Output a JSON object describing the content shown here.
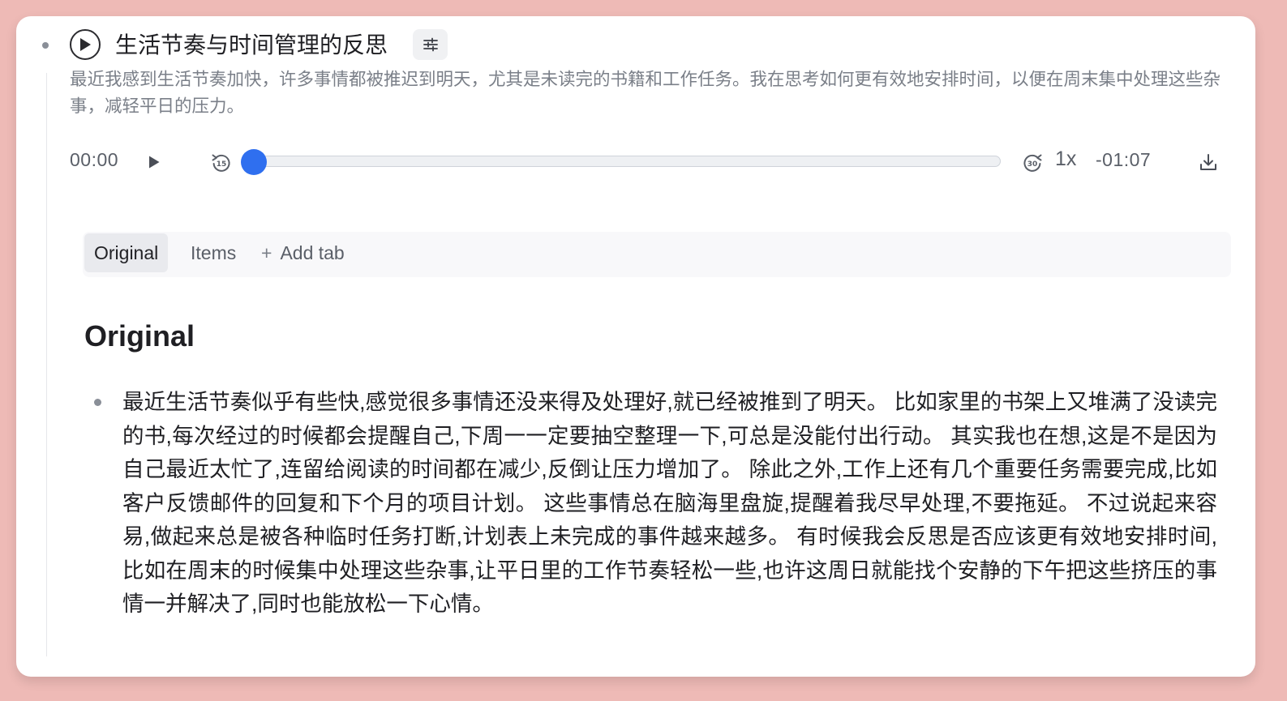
{
  "note": {
    "title": "生活节奏与时间管理的反思",
    "summary": "最近我感到生活节奏加快，许多事情都被推迟到明天，尤其是未读完的书籍和工作任务。我在思考如何更有效地安排时间，以便在周末集中处理这些杂事，减轻平日的压力。"
  },
  "player": {
    "current_time": "00:00",
    "remaining_time": "-01:07",
    "speed": "1x",
    "rewind_seconds": "15",
    "forward_seconds": "30",
    "progress": 0
  },
  "tabs": {
    "original": "Original",
    "items": "Items",
    "add": "Add tab",
    "add_symbol": "+"
  },
  "content": {
    "heading": "Original",
    "paragraph": "最近生活节奏似乎有些快,感觉很多事情还没来得及处理好,就已经被推到了明天。 比如家里的书架上又堆满了没读完的书,每次经过的时候都会提醒自己,下周一一定要抽空整理一下,可总是没能付出行动。 其实我也在想,这是不是因为自己最近太忙了,连留给阅读的时间都在减少,反倒让压力增加了。 除此之外,工作上还有几个重要任务需要完成,比如客户反馈邮件的回复和下个月的项目计划。 这些事情总在脑海里盘旋,提醒着我尽早处理,不要拖延。 不过说起来容易,做起来总是被各种临时任务打断,计划表上未完成的事件越来越多。 有时候我会反思是否应该更有效地安排时间,比如在周末的时候集中处理这些杂事,让平日里的工作节奏轻松一些,也许这周日就能找个安静的下午把这些挤压的事情一并解决了,同时也能放松一下心情。"
  },
  "colors": {
    "background": "#eebab6",
    "accent": "#2f6fef"
  },
  "icons": {
    "play": "play-icon",
    "settings": "sliders-icon",
    "rewind": "rewind-15-icon",
    "forward": "forward-30-icon",
    "download": "download-icon"
  }
}
